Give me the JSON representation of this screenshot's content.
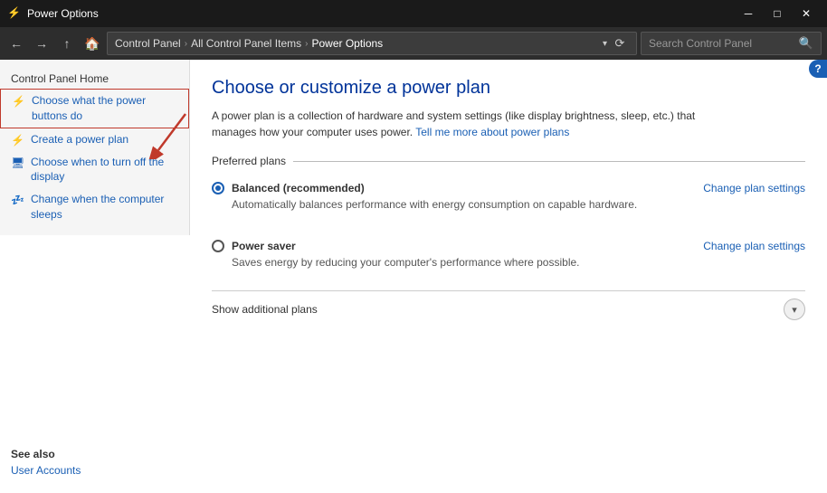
{
  "titlebar": {
    "icon": "⚡",
    "title": "Power Options",
    "minimize_label": "─",
    "maximize_label": "□",
    "close_label": "✕"
  },
  "addressbar": {
    "back_label": "←",
    "forward_label": "→",
    "up_label": "↑",
    "home_label": "🏠",
    "breadcrumb": [
      {
        "label": "Control Panel",
        "id": "control-panel"
      },
      {
        "label": "All Control Panel Items",
        "id": "all-items"
      },
      {
        "label": "Power Options",
        "id": "power-options"
      }
    ],
    "search_placeholder": "Search Control Panel",
    "refresh_label": "⟳"
  },
  "sidebar": {
    "top_label": "Control Panel Home",
    "items": [
      {
        "id": "power-buttons",
        "label": "Choose what the power buttons do",
        "icon": "⚡",
        "active": true
      },
      {
        "id": "create-plan",
        "label": "Create a power plan",
        "icon": "⚡"
      },
      {
        "id": "turn-off-display",
        "label": "Choose when to turn off the display",
        "icon": "🖥"
      },
      {
        "id": "sleep",
        "label": "Change when the computer sleeps",
        "icon": "💤"
      }
    ],
    "see_also": {
      "title": "See also",
      "links": [
        {
          "label": "User Accounts"
        }
      ]
    }
  },
  "content": {
    "title": "Choose or customize a power plan",
    "description_text": "A power plan is a collection of hardware and system settings (like display brightness, sleep, etc.) that manages how your computer uses power.",
    "description_link_text": "Tell me more about power plans",
    "section_label": "Preferred plans",
    "plans": [
      {
        "id": "balanced",
        "name": "Balanced (recommended)",
        "desc": "Automatically balances performance with energy consumption on capable hardware.",
        "selected": true,
        "change_link": "Change plan settings"
      },
      {
        "id": "power-saver",
        "name": "Power saver",
        "desc": "Saves energy by reducing your computer's performance where possible.",
        "selected": false,
        "change_link": "Change plan settings"
      }
    ],
    "show_additional_plans": "Show additional plans"
  },
  "help": {
    "label": "?"
  }
}
